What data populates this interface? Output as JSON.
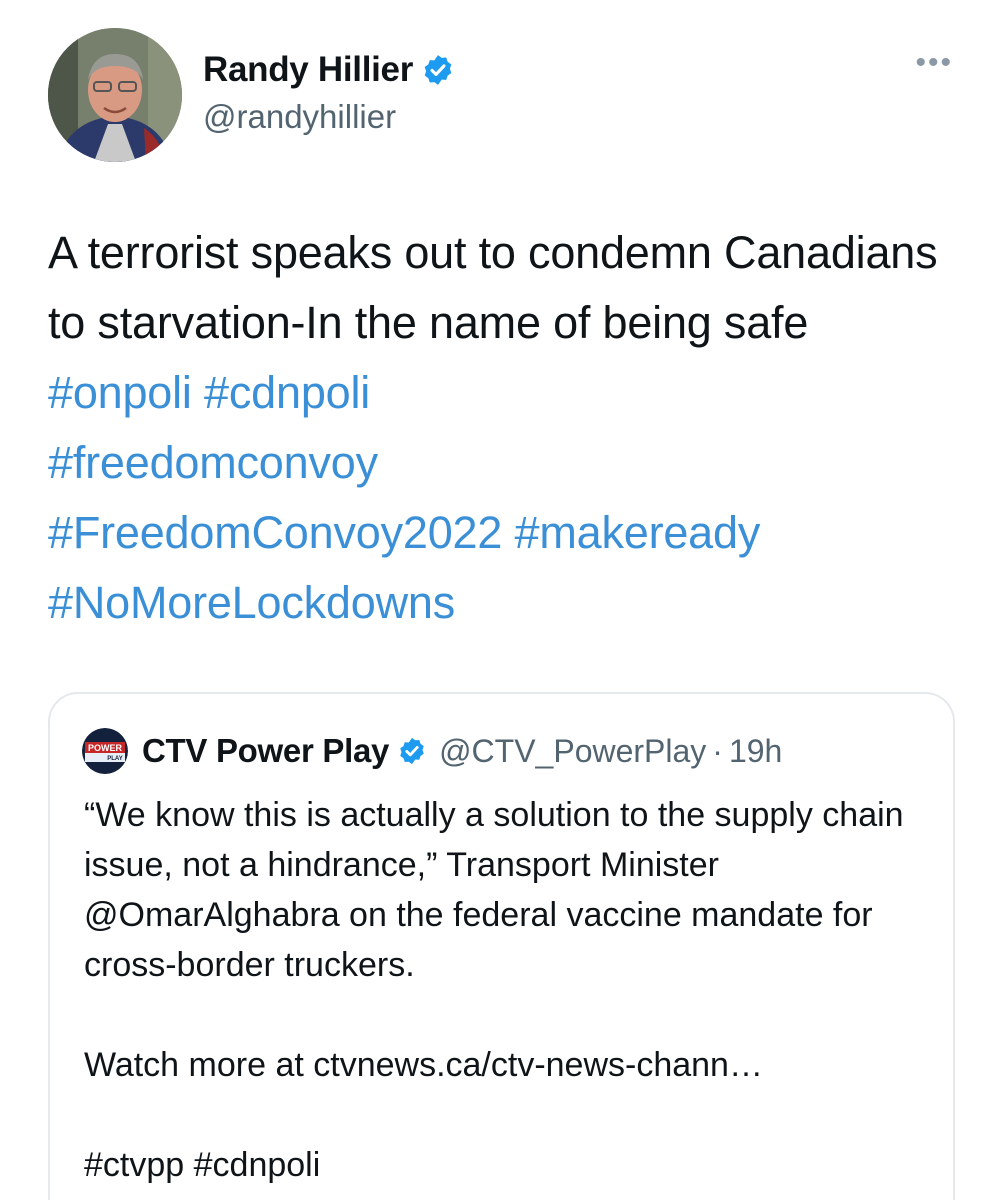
{
  "author": {
    "name": "Randy Hillier",
    "handle": "@randyhillier",
    "verified_icon": "verified-badge-icon"
  },
  "more_label": "•••",
  "tweet": {
    "text": "A terrorist speaks out to condemn Canadians to starvation-In the name of being safe",
    "hashtags": [
      "#onpoli",
      "#cdnpoli",
      "#freedomconvoy",
      "#FreedomConvoy2022",
      "#makeready",
      "#NoMoreLockdowns"
    ]
  },
  "quote": {
    "name": "CTV Power Play",
    "handle": "@CTV_PowerPlay",
    "dot": "·",
    "time": "19h",
    "avatar_top": "POWER",
    "avatar_bottom": "PLAY",
    "paragraph1": "“We know this is actually a solution to the supply chain issue, not a hindrance,” Transport Minister @OmarAlghabra on the federal vaccine mandate for cross-border truckers.",
    "paragraph2": "Watch more at ctvnews.ca/ctv-news-chann…",
    "paragraph3": "#ctvpp #cdnpoli"
  },
  "colors": {
    "link": "#3a8fd6",
    "verified": "#1d9bf0",
    "muted": "#536471",
    "border": "#e6e9ec"
  }
}
